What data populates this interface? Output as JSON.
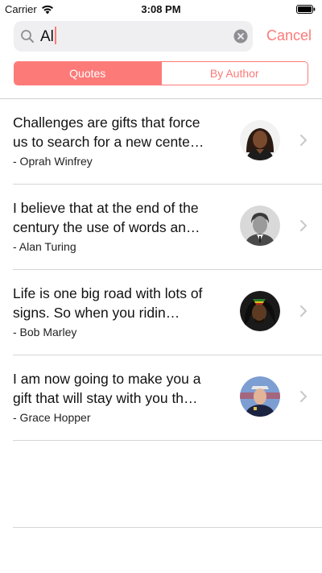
{
  "status_bar": {
    "carrier": "Carrier",
    "time": "3:08 PM"
  },
  "search": {
    "value": "Al",
    "cancel_label": "Cancel"
  },
  "segments": [
    {
      "label": "Quotes",
      "selected": true
    },
    {
      "label": "By Author",
      "selected": false
    }
  ],
  "quotes": [
    {
      "text": "Challenges are gifts that force us to search for a new cente…",
      "author": "- Oprah Winfrey",
      "avatar_icon": "portrait-icon"
    },
    {
      "text": "I believe that at the end of the century the use of words an…",
      "author": "- Alan Turing",
      "avatar_icon": "portrait-icon"
    },
    {
      "text": "Life is one big road with lots of signs. So when you ridin…",
      "author": "- Bob Marley",
      "avatar_icon": "portrait-icon"
    },
    {
      "text": "I am now going to make you a gift that will stay with you th…",
      "author": "- Grace Hopper",
      "avatar_icon": "portrait-icon"
    }
  ],
  "colors": {
    "accent": "#fc7a78",
    "search_background": "#efeff1",
    "divider": "#d6d6da"
  }
}
